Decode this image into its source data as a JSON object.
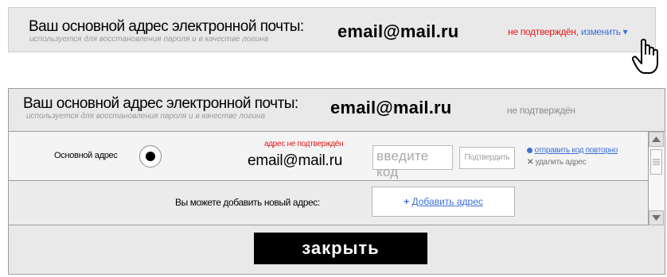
{
  "top_panel": {
    "title": "Ваш основной адрес электронной почты:",
    "subtitle": "используется для восстановления пароля и в качестве логина",
    "email": "email@mail.ru",
    "status_unconfirmed": "не подтверждён,",
    "change_link": "изменить ▾",
    "status_color": "#e11a1a",
    "link_color": "#3c6fd8"
  },
  "expanded_panel": {
    "title": "Ваш основной адрес электронной почты:",
    "subtitle": "используется для восстановления пароля и в качестве логина",
    "email": "email@mail.ru",
    "status": "не подтверждён",
    "row": {
      "primary_label": "Основной адрес",
      "warning": "адрес не подтверждён",
      "email": "email@mail.ru",
      "code_placeholder": "введите код",
      "confirm_button": "Подтвердить",
      "resend_link": "отправить код повторно",
      "delete_link": "удалить адрес",
      "resend_icon": "circle-dot-icon",
      "delete_icon": "x-icon"
    },
    "add_row": {
      "prompt": "Вы можете добавить новый адрес:",
      "add_plus": "+",
      "add_button": "Добавить адрес"
    },
    "close_button": "закрыть"
  }
}
